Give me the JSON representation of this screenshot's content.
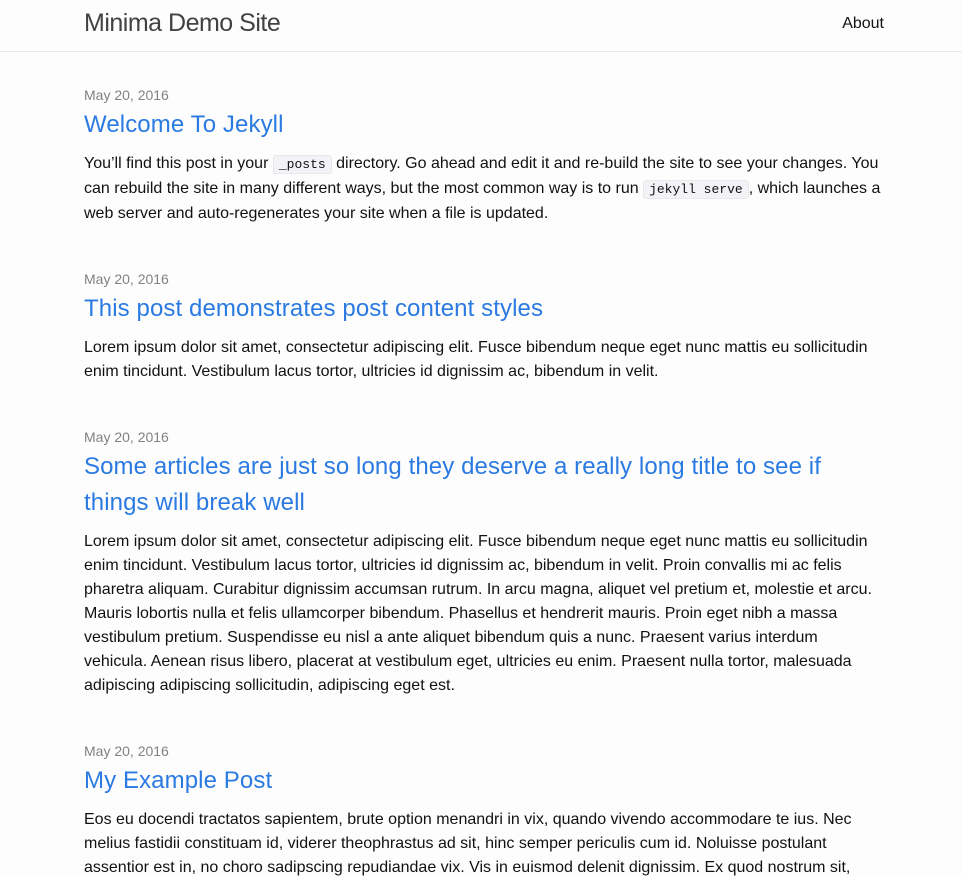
{
  "header": {
    "site_title": "Minima Demo Site",
    "nav": [
      {
        "label": "About"
      }
    ]
  },
  "posts": [
    {
      "date": "May 20, 2016",
      "title": "Welcome To Jekyll",
      "excerpt": {
        "part1": "You’ll find this post in your ",
        "code1": "_posts",
        "part2": " directory. Go ahead and edit it and re-build the site to see your changes. You can rebuild the site in many different ways, but the most common way is to run ",
        "code2": "jekyll serve",
        "part3": ", which launches a web server and auto-regenerates your site when a file is updated."
      }
    },
    {
      "date": "May 20, 2016",
      "title": "This post demonstrates post content styles",
      "excerpt": "Lorem ipsum dolor sit amet, consectetur adipiscing elit. Fusce bibendum neque eget nunc mattis eu sollicitudin enim tincidunt. Vestibulum lacus tortor, ultricies id dignissim ac, bibendum in velit."
    },
    {
      "date": "May 20, 2016",
      "title": "Some articles are just so long they deserve a really long title to see if things will break well",
      "excerpt": "Lorem ipsum dolor sit amet, consectetur adipiscing elit. Fusce bibendum neque eget nunc mattis eu sollicitudin enim tincidunt. Vestibulum lacus tortor, ultricies id dignissim ac, bibendum in velit. Proin convallis mi ac felis pharetra aliquam. Curabitur dignissim accumsan rutrum. In arcu magna, aliquet vel pretium et, molestie et arcu. Mauris lobortis nulla et felis ullamcorper bibendum. Phasellus et hendrerit mauris. Proin eget nibh a massa vestibulum pretium. Suspendisse eu nisl a ante aliquet bibendum quis a nunc. Praesent varius interdum vehicula. Aenean risus libero, placerat at vestibulum eget, ultricies eu enim. Praesent nulla tortor, malesuada adipiscing adipiscing sollicitudin, adipiscing eget est."
    },
    {
      "date": "May 20, 2016",
      "title": "My Example Post",
      "excerpt": "Eos eu docendi tractatos sapientem, brute option menandri in vix, quando vivendo accommodare te ius. Nec melius fastidii constituam id, viderer theophrastus ad sit, hinc semper periculis cum id. Noluisse postulant assentior est in, no choro sadipscing repudiandae vix. Vis in euismod delenit dignissim. Ex quod nostrum sit, suas decore animal id ius, nobis volutpat te mea."
    }
  ]
}
